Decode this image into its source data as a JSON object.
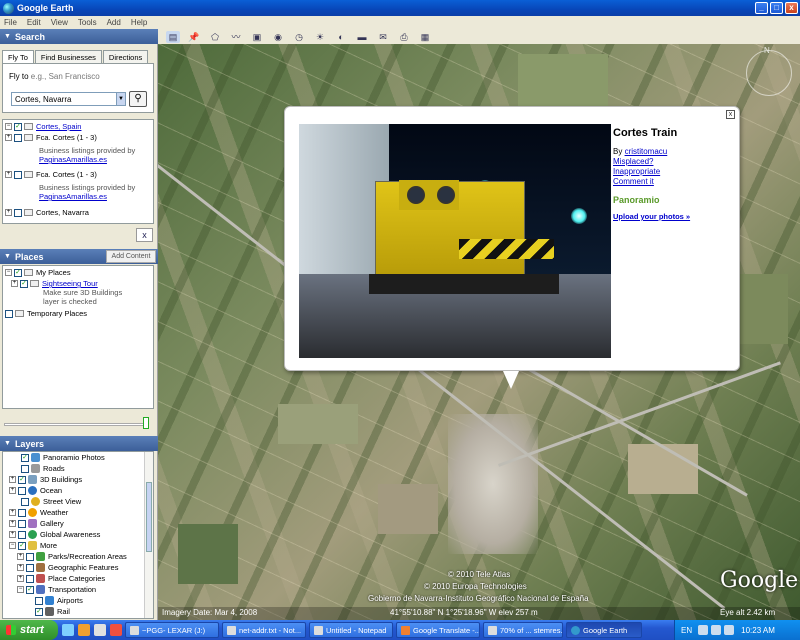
{
  "window": {
    "title": "Google Earth",
    "minimize": "_",
    "maximize": "□",
    "close": "x"
  },
  "menu": [
    "File",
    "Edit",
    "View",
    "Tools",
    "Add",
    "Help"
  ],
  "search": {
    "header": "Search",
    "tabs": [
      "Fly To",
      "Find Businesses",
      "Directions"
    ],
    "flyto_label": "Fly to",
    "flyto_example": "e.g., San Francisco",
    "input_value": "Cortes, Navarra",
    "results": [
      {
        "label": "Cortes, Spain",
        "link": true
      },
      {
        "label": "Fca. Cortes (1 - 3)",
        "note1": "Business listings provided by",
        "note2": "PaginasAmarillas.es"
      },
      {
        "label": "Fca. Cortes (1 - 3)",
        "note1": "Business listings provided by",
        "note2": "PaginasAmarillas.es"
      },
      {
        "label": "Cortes, Navarra"
      }
    ],
    "clear": "x"
  },
  "places": {
    "header": "Places",
    "add_content": "Add Content",
    "my_places": "My Places",
    "sightseeing": "Sightseeing Tour",
    "sightseeing_note1": "Make sure 3D Buildings",
    "sightseeing_note2": "layer is checked",
    "temporary": "Temporary Places"
  },
  "layers": {
    "header": "Layers",
    "items": [
      {
        "label": "Panoramio Photos",
        "color": "#4a90d0"
      },
      {
        "label": "Roads",
        "color": "#9a9a9a"
      },
      {
        "label": "3D Buildings",
        "color": "#7aa0c0"
      },
      {
        "label": "Ocean",
        "color": "#2a70c0"
      },
      {
        "label": "Street View",
        "color": "#e0b020"
      },
      {
        "label": "Weather",
        "color": "#f0a000"
      },
      {
        "label": "Gallery",
        "color": "#a070c0"
      },
      {
        "label": "Global Awareness",
        "color": "#2aa050"
      },
      {
        "label": "More",
        "color": "#e0c040"
      },
      {
        "label": "Parks/Recreation Areas",
        "color": "#40a040"
      },
      {
        "label": "Geographic Features",
        "color": "#a07040"
      },
      {
        "label": "Place Categories",
        "color": "#c05050"
      },
      {
        "label": "Transportation",
        "color": "#5070c0"
      },
      {
        "label": "Airports",
        "color": "#3080d0"
      },
      {
        "label": "Rail",
        "color": "#606060"
      }
    ]
  },
  "balloon": {
    "title": "Cortes Train",
    "by": "By ",
    "author": "cristitomacu",
    "links": [
      "Misplaced?",
      "Inappropriate",
      "Comment it"
    ],
    "brand": "Panoramio",
    "upload": "Upload your photos »",
    "close": "x"
  },
  "map": {
    "copyright1": "© 2010 Tele Atlas",
    "copyright2": "© 2010 Europa Technologies",
    "copyright3": "Gobierno de Navarra-Instituto Geográfico Nacional de España",
    "imagery_date": "Imagery Date: Mar 4, 2008",
    "coords": "41°55'10.88\" N    1°25'18.96\" W    elev  257 m",
    "eye_alt": "Eye alt  2.42 km",
    "logo": "Google"
  },
  "taskbar": {
    "start": "start",
    "tasks": [
      {
        "label": "~PGG- LEXAR (J:)"
      },
      {
        "label": "net-addr.txt - Not..."
      },
      {
        "label": "Untitled - Notepad"
      },
      {
        "label": "Google Translate -..."
      },
      {
        "label": "70% of ... stemres..."
      },
      {
        "label": "Google Earth",
        "active": true
      }
    ],
    "lang": "EN",
    "clock": "10:23 AM"
  }
}
